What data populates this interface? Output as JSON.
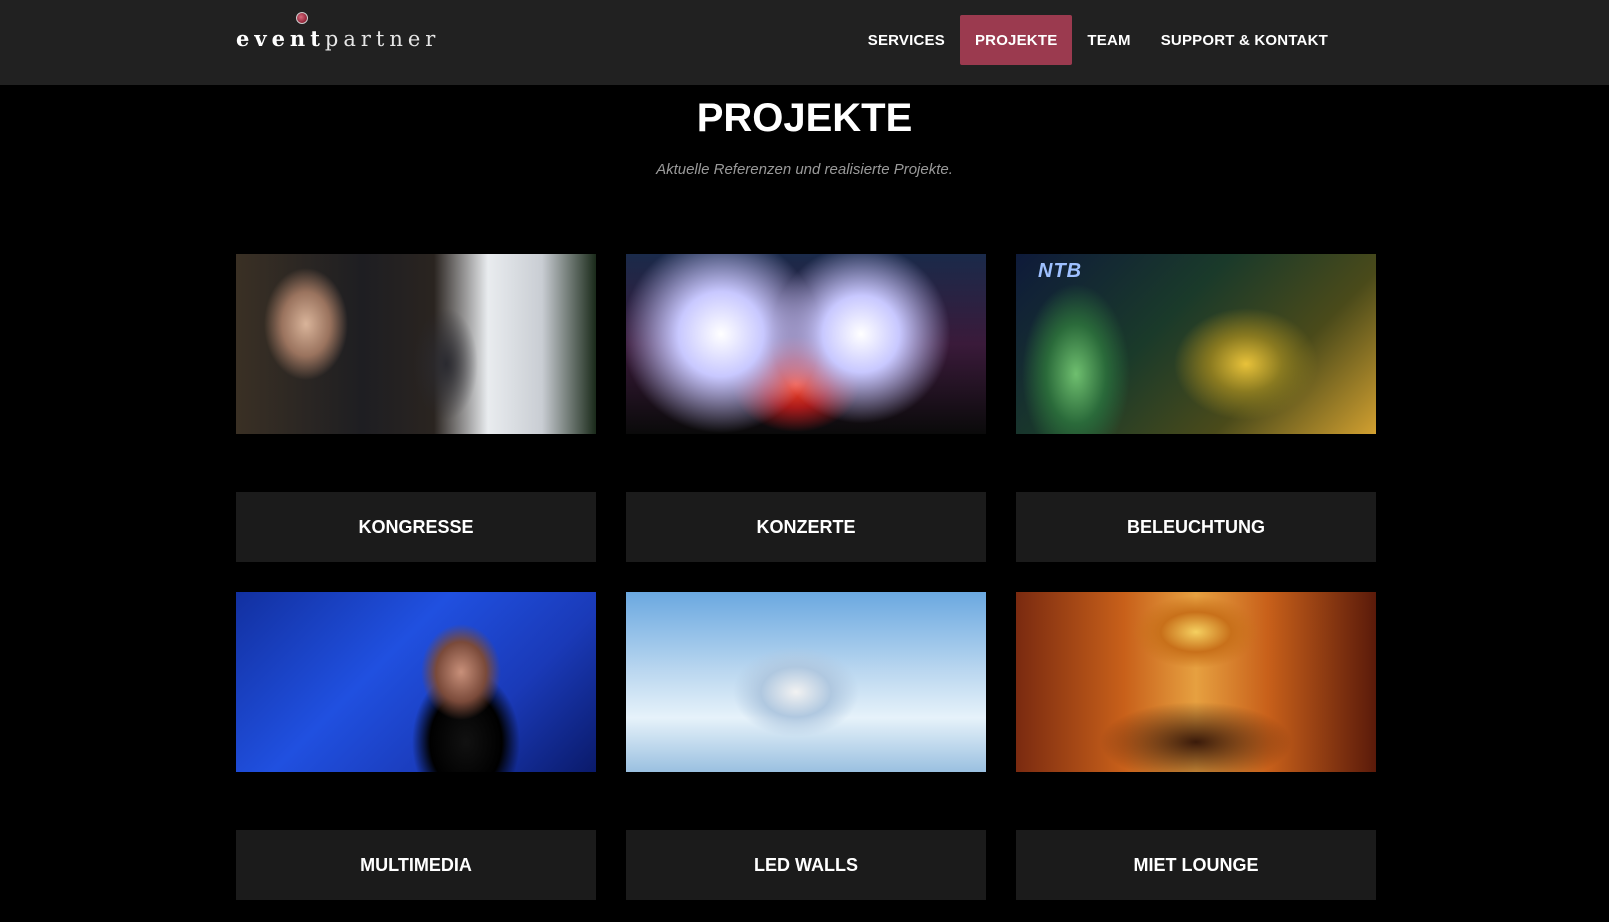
{
  "header": {
    "logo": {
      "bold": "event",
      "light": "partner"
    },
    "nav": [
      {
        "label": "SERVICES",
        "active": false
      },
      {
        "label": "PROJEKTE",
        "active": true
      },
      {
        "label": "TEAM",
        "active": false
      },
      {
        "label": "SUPPORT & KONTAKT",
        "active": false
      }
    ],
    "accent_color": "#9b3a4f"
  },
  "main": {
    "title": "PROJEKTE",
    "subtitle": "Aktuelle Referenzen und realisierte Projekte.",
    "cards": [
      {
        "label": "KONGRESSE",
        "image": "conference-speaker-photo"
      },
      {
        "label": "KONZERTE",
        "image": "concert-stage-photo"
      },
      {
        "label": "BELEUCHTUNG",
        "image": "illuminated-building-photo",
        "image_text": "NTB"
      },
      {
        "label": "MULTIMEDIA",
        "image": "performer-blue-stage-photo"
      },
      {
        "label": "LED WALLS",
        "image": "ski-racer-led-wall-photo"
      },
      {
        "label": "MIET LOUNGE",
        "image": "lounge-dining-photo"
      }
    ]
  }
}
